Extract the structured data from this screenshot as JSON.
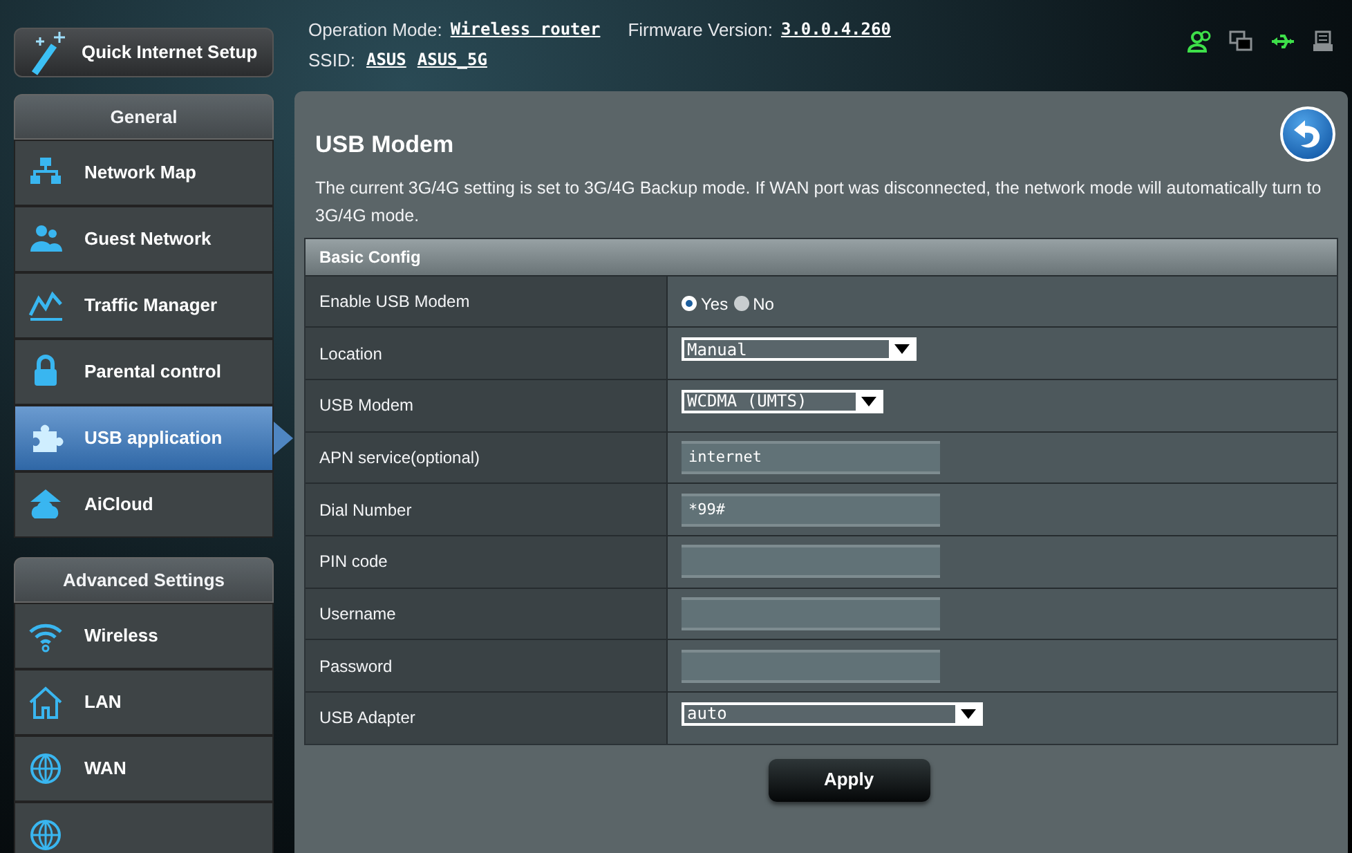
{
  "quick_setup": {
    "label": "Quick Internet Setup"
  },
  "header": {
    "mode_label": "Operation Mode:",
    "mode": "Wireless router",
    "firmware_label": "Firmware Version:",
    "firmware": "3.0.0.4.260",
    "ssid_label": "SSID:",
    "ssids": [
      "ASUS",
      "ASUS_5G"
    ]
  },
  "status_icons": [
    {
      "kind": "clients",
      "on": true
    },
    {
      "kind": "devices",
      "on": false
    },
    {
      "kind": "usb",
      "on": true
    },
    {
      "kind": "printer",
      "on": false
    }
  ],
  "sidebar": [
    {
      "title": "General",
      "items": [
        {
          "label": "Network Map",
          "selected": false
        },
        {
          "label": "Guest Network",
          "selected": false
        },
        {
          "label": "Traffic Manager",
          "selected": false
        },
        {
          "label": "Parental control",
          "selected": false
        },
        {
          "label": "USB application",
          "selected": true
        },
        {
          "label": "AiCloud",
          "selected": false
        }
      ]
    },
    {
      "title": "Advanced Settings",
      "items": [
        {
          "label": "Wireless",
          "selected": false
        },
        {
          "label": "LAN",
          "selected": false
        },
        {
          "label": "WAN",
          "selected": false
        },
        {
          "selected": false
        }
      ]
    }
  ],
  "page": {
    "title": "USB Modem",
    "description": "The current 3G/4G setting is set to 3G/4G Backup mode. If WAN port was disconnected, the network mode will automatically turn to 3G/4G mode.",
    "section": "Basic Config",
    "rows": [
      {
        "label": "Enable USB Modem",
        "kind": "radio",
        "options": [
          {
            "label": "Yes",
            "selected": true
          },
          {
            "label": "No",
            "selected": false
          }
        ]
      },
      {
        "label": "Location",
        "kind": "select",
        "value": "Manual"
      },
      {
        "label": "USB Modem",
        "kind": "select",
        "value": "WCDMA (UMTS)"
      },
      {
        "label": "APN service(optional)",
        "kind": "text",
        "value": "internet"
      },
      {
        "label": "Dial Number",
        "kind": "text",
        "value": "*99#"
      },
      {
        "label": "PIN code",
        "kind": "text"
      },
      {
        "label": "Username",
        "kind": "text"
      },
      {
        "label": "Password",
        "kind": "text"
      },
      {
        "label": "USB Adapter",
        "kind": "select",
        "value": "auto"
      }
    ],
    "apply": "Apply"
  }
}
